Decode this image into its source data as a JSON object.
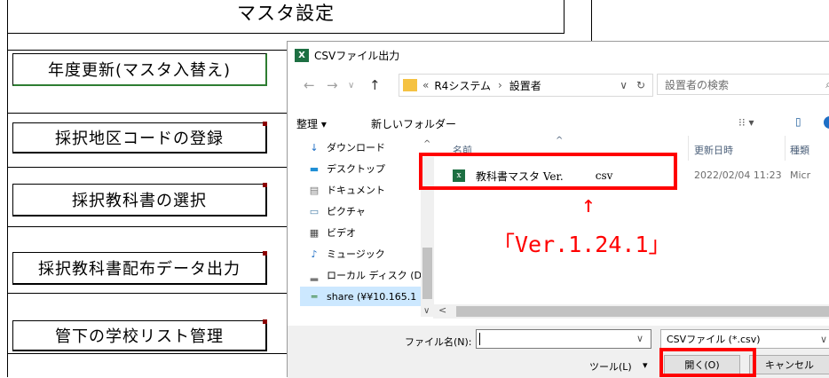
{
  "sheet": {
    "title": "マスタ設定",
    "buttons": [
      {
        "label": "年度更新(マスタ入替え)"
      },
      {
        "label": "採択地区コードの登録"
      },
      {
        "label": "採択教科書の選択"
      },
      {
        "label": "採択教科書配布データ出力"
      },
      {
        "label": "管下の学校リスト管理"
      }
    ]
  },
  "dialog": {
    "title": "CSVファイル出力",
    "icon_text": "X",
    "nav": {
      "back": "←",
      "forward": "→",
      "dropdown": "∨",
      "up": "↑"
    },
    "breadcrumb": {
      "prefix": "«",
      "segments": [
        "R4システム",
        "設置者"
      ],
      "separator": "›",
      "dropdown": "∨",
      "refresh": "↻"
    },
    "search_placeholder": "設置者の検索",
    "search_icon": "⌕",
    "toolbar": {
      "organize": "整理 ▾",
      "new_folder": "新しいフォルダー",
      "view_icon": "⁝⁝ ▾",
      "pane_icon": "▯"
    },
    "nav_items": [
      {
        "icon": "↓",
        "label": "ダウンロード"
      },
      {
        "icon": "▬",
        "label": "デスクトップ"
      },
      {
        "icon": "▤",
        "label": "ドキュメント"
      },
      {
        "icon": "▭",
        "label": "ピクチャ"
      },
      {
        "icon": "▦",
        "label": "ビデオ"
      },
      {
        "icon": "♪",
        "label": "ミュージック"
      },
      {
        "icon": "▂",
        "label": "ローカル ディスク (D"
      },
      {
        "icon": "═",
        "label": "share (¥¥10.165.1"
      }
    ],
    "scroll_up": "^",
    "scroll_down": "∨",
    "scroll_left": "<",
    "columns": {
      "name": "名前",
      "sort": "^",
      "date": "更新日時",
      "type": "種類"
    },
    "file": {
      "icon": "x",
      "name": "教科書マスタ Ver.",
      "ext": "csv",
      "date": "2022/02/04 11:23",
      "type": "Micr"
    },
    "filename_label": "ファイル名(N):",
    "filename_dropdown": "∨",
    "filetype": "CSVファイル (*.csv)",
    "filetype_dropdown": "∨",
    "tools_label": "ツール(L)",
    "tools_dropdown": "▾",
    "open_button": "開く(O)",
    "cancel_button": "キャンセル"
  },
  "annotation": {
    "arrow": "↑",
    "version_text": "「Ver.1.24.1」"
  },
  "colors": {
    "annotation": "#ff0000",
    "excel_green": "#1d6f42"
  }
}
